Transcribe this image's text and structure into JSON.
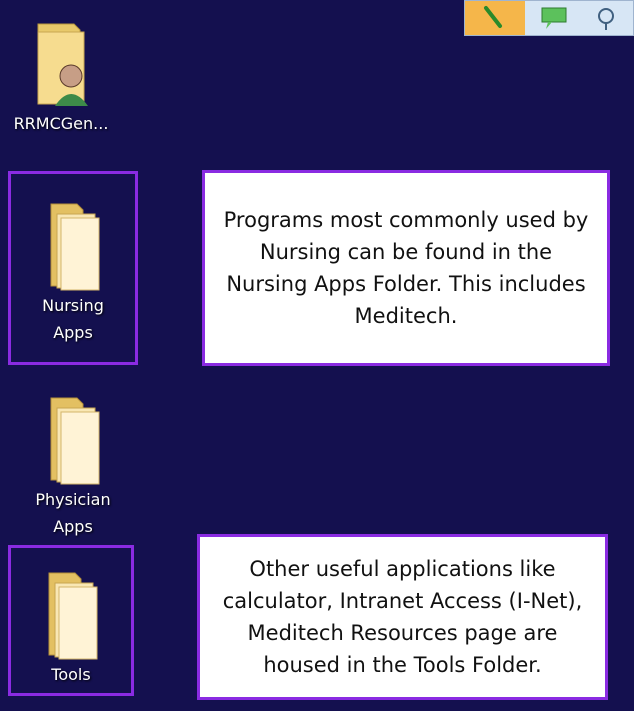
{
  "desktop": {
    "icons": [
      {
        "label": "RRMCGen...",
        "icon": "user-folder-icon"
      },
      {
        "label": "Nursing\nApps",
        "icon": "folder-icon"
      },
      {
        "label": "Physician\nApps",
        "icon": "folder-icon"
      },
      {
        "label": "Tools",
        "icon": "folder-icon"
      }
    ]
  },
  "annotations": {
    "nursing_note": "Programs most commonly used by Nursing can be found in the Nursing Apps Folder.  This includes Meditech.",
    "tools_note": "Other useful applications like calculator, Intranet Access (I-Net), Meditech Resources page are housed in the Tools Folder."
  },
  "toolbar": {
    "icons": [
      "search-tool-icon",
      "chat-tool-icon",
      "network-tool-icon"
    ]
  },
  "colors": {
    "desktop_bg": "#14104f",
    "highlight_border": "#8a2be2",
    "folder_yellow": "#f2d27a"
  }
}
